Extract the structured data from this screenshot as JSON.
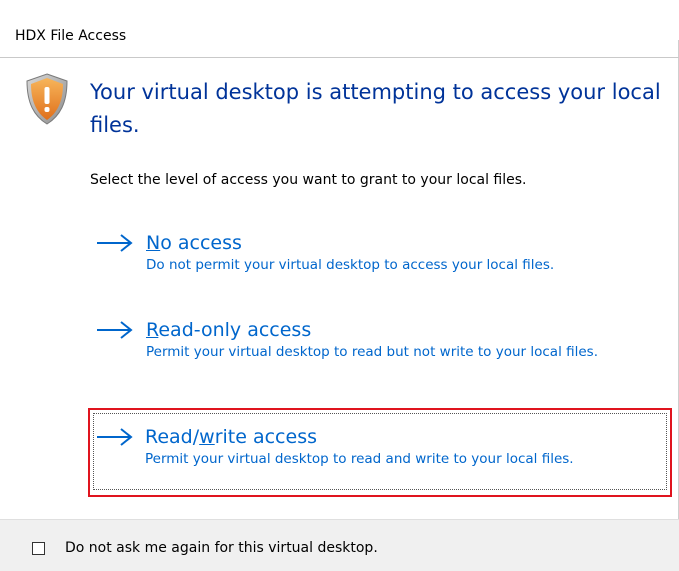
{
  "window": {
    "title": "HDX File Access"
  },
  "dialog": {
    "icon": "shield-warning-icon",
    "main_instruction": "Your virtual desktop is attempting to access your local files.",
    "content": "Select the level of access you want to grant to your local files."
  },
  "options": [
    {
      "title_pre": "",
      "title_key": "N",
      "title_post": "o access",
      "description": "Do not permit your virtual desktop to access your local files."
    },
    {
      "title_pre": "",
      "title_key": "R",
      "title_post": "ead-only access",
      "description": "Permit your virtual desktop to read but not write to your local files."
    },
    {
      "title_pre": "Read/",
      "title_key": "w",
      "title_post": "rite access",
      "description": "Permit your virtual desktop to read and write to your local files.",
      "focused": true,
      "highlighted": true
    }
  ],
  "footer": {
    "checkbox_label": "Do not ask me again for this virtual desktop.",
    "checkbox_checked": false
  },
  "colors": {
    "instruction": "#003399",
    "link": "#0066cc",
    "highlight": "#e0141e",
    "footer_bg": "#f0f0f0"
  }
}
